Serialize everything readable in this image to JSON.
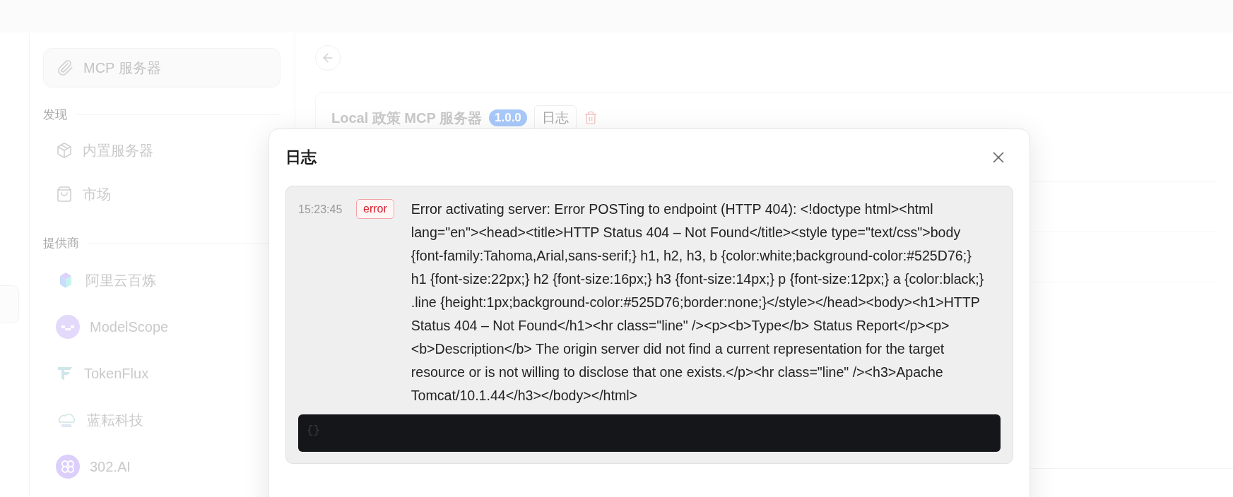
{
  "sidebar": {
    "mcp_button": {
      "label": "MCP 服务器",
      "selected": true
    },
    "sections": [
      {
        "heading": "发现",
        "items": [
          {
            "label": "内置服务器",
            "kind": "builtin"
          },
          {
            "label": "市场",
            "kind": "market"
          }
        ]
      },
      {
        "heading": "提供商",
        "items": [
          {
            "label": "阿里云百炼",
            "kind": "bailian"
          },
          {
            "label": "ModelScope",
            "kind": "modelscope"
          },
          {
            "label": "TokenFlux",
            "kind": "tokenflux"
          },
          {
            "label": "蓝耘科技",
            "kind": "lanyun"
          },
          {
            "label": "302.AI",
            "kind": "ai302"
          }
        ]
      }
    ]
  },
  "server": {
    "name": "Local 政策 MCP 服务器",
    "version": "1.0.0",
    "log_button": "日志"
  },
  "dialog": {
    "title": "日志",
    "entries": [
      {
        "time": "15:23:45",
        "level": "error",
        "message": "Error activating server: Error POSTing to endpoint (HTTP 404): <!doctype html><html lang=\"en\"><head><title>HTTP Status 404 – Not Found</title><style type=\"text/css\">body {font-family:Tahoma,Arial,sans-serif;} h1, h2, h3, b {color:white;background-color:#525D76;} h1 {font-size:22px;} h2 {font-size:16px;} h3 {font-size:14px;} p {font-size:12px;} a {color:black;} .line {height:1px;background-color:#525D76;border:none;}</style></head><body><h1>HTTP Status 404 – Not Found</h1><hr class=\"line\" /><p><b>Type</b> Status Report</p><p><b>Description</b> The origin server did not find a current representation for the target resource or is not willing to disclose that one exists.</p><hr class=\"line\" /><h3>Apache Tomcat/10.1.44</h3></body></html>",
        "detail": "{}"
      }
    ]
  }
}
